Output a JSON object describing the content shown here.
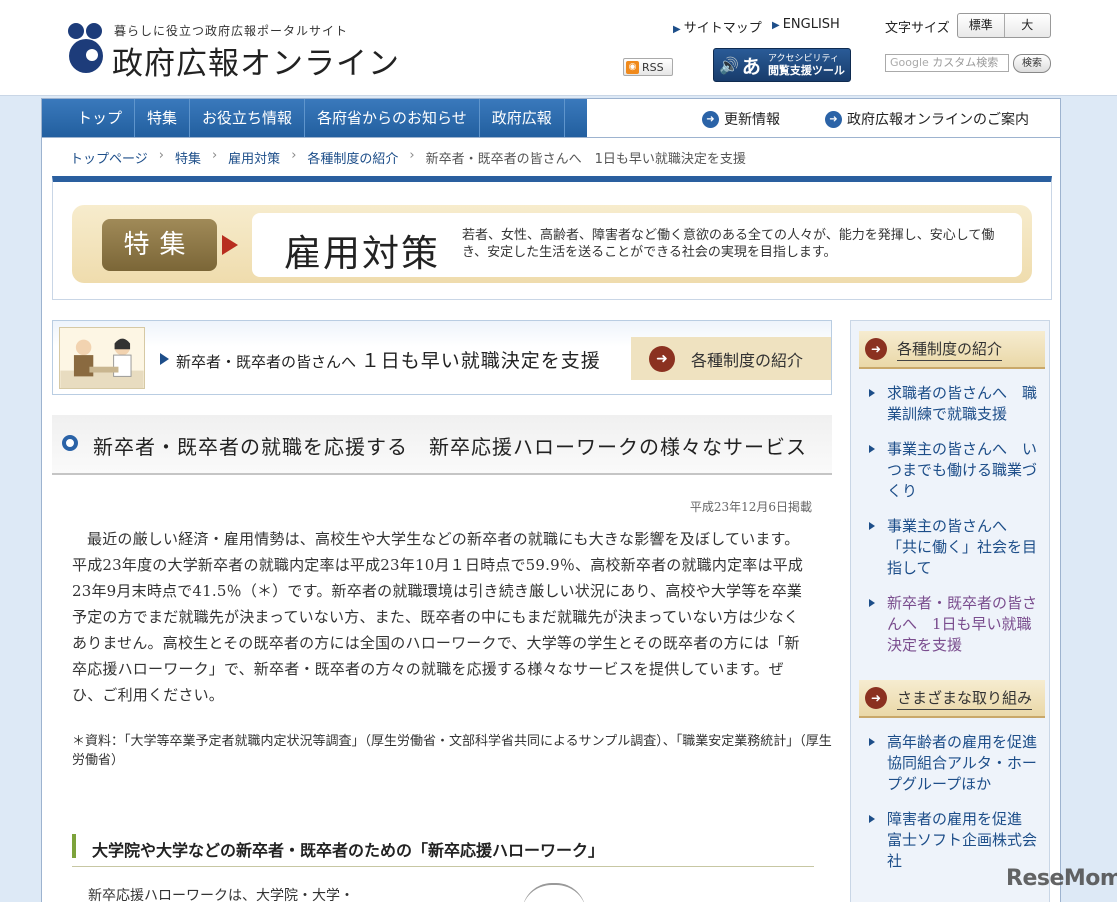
{
  "header": {
    "tagline": "暮らしに役立つ政府広報ポータルサイト",
    "site_title": "政府広報オンライン",
    "links": {
      "sitemap": "サイトマップ",
      "english": "ENGLISH"
    },
    "font_size_label": "文字サイズ",
    "font_size_options": [
      "標準",
      "大"
    ],
    "rss": "RSS",
    "accessibility": {
      "line1": "アクセシビリティ",
      "line2": "閲覧支援ツール",
      "char": "あ"
    },
    "search": {
      "placeholder": "カスタム検索",
      "google": "Google",
      "button": "検索"
    }
  },
  "nav": {
    "items": [
      "トップ",
      "特集",
      "お役立ち情報",
      "各府省からのお知らせ",
      "政府広報"
    ],
    "right": [
      "更新情報",
      "政府広報オンラインのご案内"
    ]
  },
  "breadcrumb": [
    "トップページ",
    "特集",
    "雇用対策",
    "各種制度の紹介",
    "新卒者・既卒者の皆さんへ　1日も早い就職決定を支援"
  ],
  "banner": {
    "tag": "特集",
    "title": "雇用対策",
    "description": "若者、女性、高齢者、障害者など働く意欲のある全ての人々が、能力を発揮し、安心して働き、安定した生活を送ることができる社会の実現を目指します。"
  },
  "topic": {
    "prefix": "新卒者・既卒者の皆さんへ",
    "main": "１日も早い就職決定を支援",
    "category": "各種制度の紹介"
  },
  "article": {
    "title": "新卒者・既卒者の就職を応援する　新卒応援ハローワークの様々なサービス",
    "date": "平成23年12月6日掲載",
    "body": "最近の厳しい経済・雇用情勢は、高校生や大学生などの新卒者の就職にも大きな影響を及ぼしています。平成23年度の大学新卒者の就職内定率は平成23年10月１日時点で59.9％、高校新卒者の就職内定率は平成23年9月末時点で41.5％（＊）です。新卒者の就職環境は引き続き厳しい状況にあり、高校や大学等を卒業予定の方でまだ就職先が決まっていない方、また、既卒者の中にもまだ就職先が決まっていない方は少なくありません。高校生とその既卒者の方には全国のハローワークで、大学等の学生とその既卒者の方には「新卒応援ハローワーク」で、新卒者・既卒者の方々の就職を応援する様々なサービスを提供しています。ぜひ、ご利用ください。",
    "source_note": "＊資料：「大学等卒業予定者就職内定状況等調査」（厚生労働省・文部科学省共同によるサンプル調査）、「職業安定業務統計」（厚生労働省）",
    "sub_title": "大学院や大学などの新卒者・既卒者のための「新卒応援ハローワーク」",
    "sub_body_start": "新卒応援ハローワークは、大学院・大学・"
  },
  "sidebar": {
    "section1": {
      "title": "各種制度の紹介",
      "items": [
        {
          "label": "求職者の皆さんへ　職業訓練で就職支援",
          "visited": false
        },
        {
          "label": "事業主の皆さんへ　いつまでも働ける職業づくり",
          "visited": false
        },
        {
          "label": "事業主の皆さんへ　「共に働く」社会を目指して",
          "visited": false
        },
        {
          "label": "新卒者・既卒者の皆さんへ　1日も早い就職決定を支援",
          "visited": true
        }
      ]
    },
    "section2": {
      "title": "さまざまな取り組み",
      "items": [
        {
          "label": "高年齢者の雇用を促進　協同組合アルタ・ホープグループほか",
          "visited": false
        },
        {
          "label": "障害者の雇用を促進　富士ソフト企画株式会社",
          "visited": false
        }
      ]
    }
  },
  "watermark": "ReseMom",
  "colors": {
    "nav_blue": "#2b68a9",
    "link": "#1d4e89",
    "visited": "#7a4d8e",
    "accent_red": "#8b3120",
    "banner_gold": "#efdcad"
  }
}
